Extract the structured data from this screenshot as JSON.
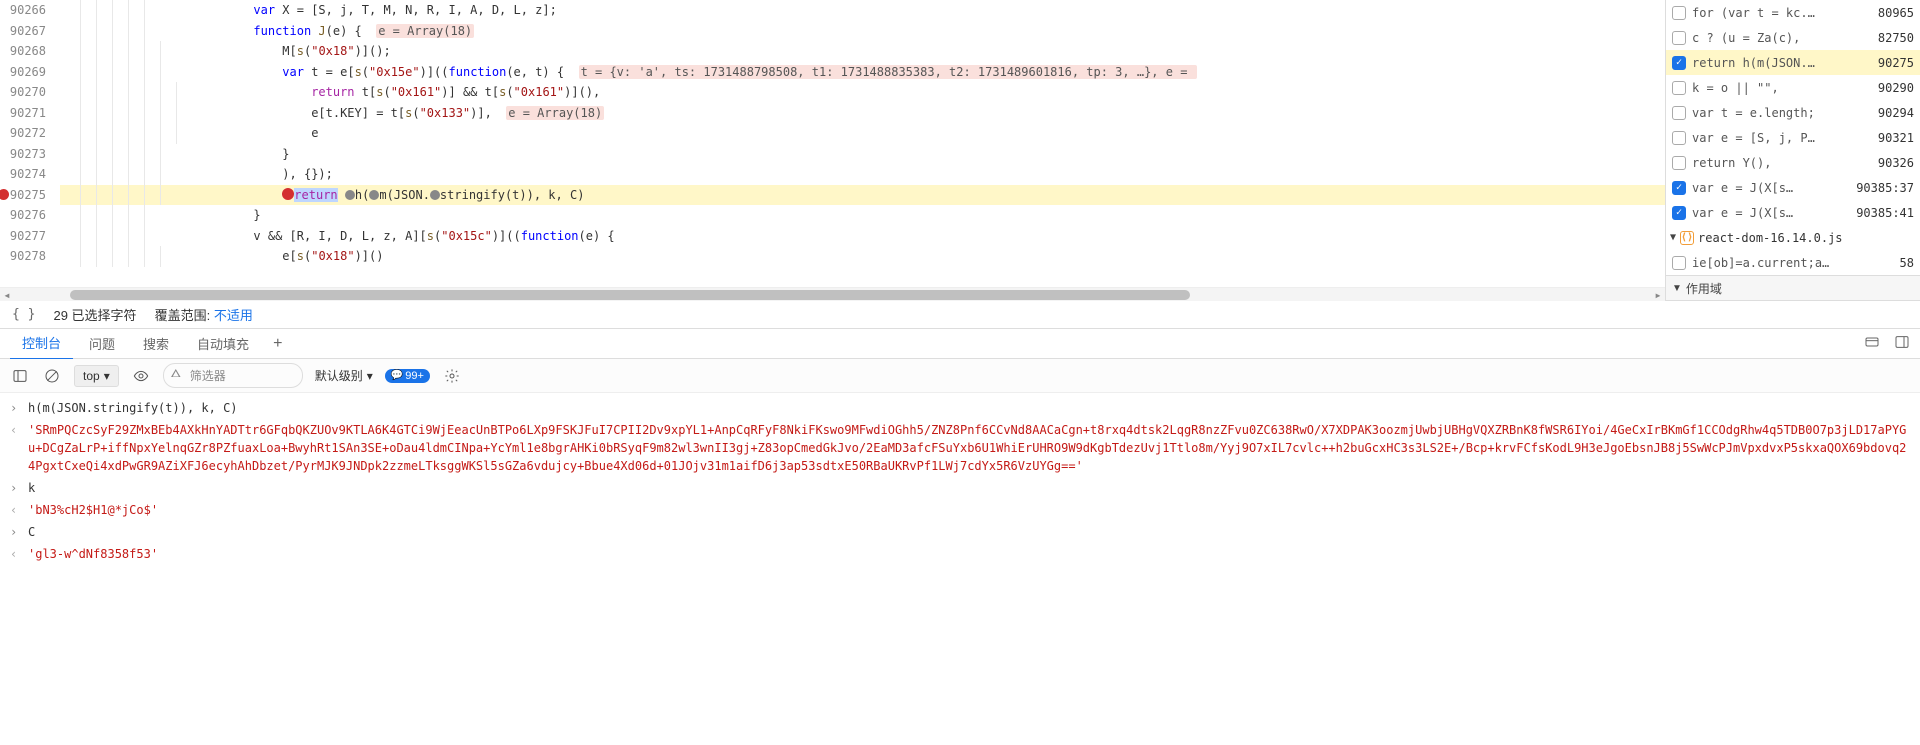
{
  "editor": {
    "lines": [
      {
        "n": 90266,
        "indent": 3,
        "pre": "",
        "html": "<span class='kw2'>var</span> X = [S, j, T, M, N, R, I, A, D, L, z];"
      },
      {
        "n": 90267,
        "indent": 3,
        "pre": "",
        "html": "<span class='kw2'>function</span> <span class='fn'>J</span>(e) {  <span class='hint'>e = Array(18)</span>"
      },
      {
        "n": 90268,
        "indent": 4,
        "pre": "",
        "html": "M[<span class='fn'>s</span>(<span class='str'>\"0x18\"</span>)]();"
      },
      {
        "n": 90269,
        "indent": 4,
        "pre": "",
        "html": "<span class='kw2'>var</span> t = e[<span class='fn'>s</span>(<span class='str'>\"0x15e\"</span>)]((<span class='kw2'>function</span>(e, t) {  <span class='hint'>t = {v: 'a', ts: 1731488798508, t1: 1731488835383, t2: 1731489601816, tp: 3, …}, e = </span>"
      },
      {
        "n": 90270,
        "indent": 5,
        "pre": "",
        "html": "<span class='kw'>return</span> t[<span class='fn'>s</span>(<span class='str'>\"0x161\"</span>)] && t[<span class='fn'>s</span>(<span class='str'>\"0x161\"</span>)](),"
      },
      {
        "n": 90271,
        "indent": 5,
        "pre": "",
        "html": "e[t.KEY] = t[<span class='fn'>s</span>(<span class='str'>\"0x133\"</span>)],  <span class='hint'>e = Array(18)</span>"
      },
      {
        "n": 90272,
        "indent": 5,
        "pre": "",
        "html": "e"
      },
      {
        "n": 90273,
        "indent": 4,
        "pre": "",
        "html": "}"
      },
      {
        "n": 90274,
        "indent": 4,
        "pre": "",
        "html": "), {});"
      },
      {
        "n": 90275,
        "indent": 4,
        "pre": "",
        "bp": true,
        "exec": true,
        "html": "<span class='bp-inline'></span><span class='kw sel'>return</span> <span class='dot-inline'></span>h(<span class='dot-inline'></span>m(JSON.<span class='dot-inline'></span>stringify(t)), k, C)"
      },
      {
        "n": 90276,
        "indent": 3,
        "pre": "",
        "html": "}"
      },
      {
        "n": 90277,
        "indent": 3,
        "pre": "",
        "html": "v && [R, I, D, L, z, A][<span class='fn'>s</span>(<span class='str'>\"0x15c\"</span>)]((<span class='kw2'>function</span>(e) {"
      },
      {
        "n": 90278,
        "indent": 4,
        "pre": "",
        "html": "e[<span class='fn'>s</span>(<span class='str'>\"0x18\"</span>)]()"
      }
    ]
  },
  "breakpoints": [
    {
      "checked": false,
      "text": "for (var t = kc.…",
      "line": "80965"
    },
    {
      "checked": false,
      "text": "c ? (u = Za(c),",
      "line": "82750"
    },
    {
      "checked": true,
      "text": "return h(m(JSON.…",
      "line": "90275",
      "selected": true
    },
    {
      "checked": false,
      "text": "k = o || \"\",",
      "line": "90290"
    },
    {
      "checked": false,
      "text": "var t = e.length;",
      "line": "90294"
    },
    {
      "checked": false,
      "text": "var e = [S, j, P…",
      "line": "90321"
    },
    {
      "checked": false,
      "text": "return Y(),",
      "line": "90326"
    },
    {
      "checked": true,
      "text": "var e = J(X[s…",
      "line": "90385:37"
    },
    {
      "checked": true,
      "text": "var e = J(X[s…",
      "line": "90385:41"
    }
  ],
  "right_file": {
    "name": "react-dom-16.14.0.js"
  },
  "right_extra": {
    "checked": false,
    "text": "ie[ob]=a.current;a…",
    "line": "58"
  },
  "right_section": "作用域",
  "status": {
    "braces": "{ }",
    "selected_chars": "29 已选择字符",
    "coverage_label": "覆盖范围:",
    "coverage_value": "不适用"
  },
  "tabs": {
    "console": "控制台",
    "issues": "问题",
    "search": "搜索",
    "autofill": "自动填充"
  },
  "toolbar": {
    "context": "top",
    "filter_placeholder": "筛选器",
    "level": "默认级别",
    "badge": "99+"
  },
  "console": [
    {
      "dir": "in",
      "kind": "expr",
      "text": "h(m(JSON.stringify(t)), k, C)"
    },
    {
      "dir": "out",
      "kind": "str",
      "text": "'SRmPQCzcSyF29ZMxBEb4AXkHnYADTtr6GFqbQKZUOv9KTLA6K4GTCi9WjEeacUnBTPo6LXp9FSKJFuI7CPII2Dv9xpYL1+AnpCqRFyF8NkiFKswo9MFwdiOGhh5/ZNZ8Pnf6CCvNd8AACaCgn+t8rxq4dtsk2LqgR8nzZFvu0ZC638RwO/X7XDPAK3oozmjUwbjUBHgVQXZRBnK8fWSR6IYoi/4GeCxIrBKmGf1CCOdgRhw4q5TDB0O7p3jLD17aPYGu+DCgZaLrP+iffNpxYelnqGZr8PZfuaxLoa+BwyhRt1SAn3SE+oDau4ldmCINpa+YcYml1e8bgrAHKi0bRSyqF9m82wl3wnII3gj+Z83opCmedGkJvo/2EaMD3afcFSuYxb6U1WhiErUHRO9W9dKgbTdezUvj1Ttlo8m/Yyj9O7xIL7cvlc++h2buGcxHC3s3LS2E+/Bcp+krvFCfsKodL9H3eJgoEbsnJB8j5SwWcPJmVpxdvxP5skxaQOX69bdovq24PgxtCxeQi4xdPwGR9AZiXFJ6ecyhAhDbzet/PyrMJK9JNDpk2zzmeLTksggWKSl5sGZa6vdujcy+Bbue4Xd06d+01JOjv31m1aifD6j3ap53sdtxE50RBaUKRvPf1LWj7cdYx5R6VzUYGg=='"
    },
    {
      "dir": "in",
      "kind": "expr",
      "text": "k"
    },
    {
      "dir": "out",
      "kind": "str",
      "text": "'bN3%cH2$H1@*jCo$'"
    },
    {
      "dir": "in",
      "kind": "expr",
      "text": "C"
    },
    {
      "dir": "out",
      "kind": "str",
      "text": "'gl3-w^dNf8358f53'"
    }
  ]
}
